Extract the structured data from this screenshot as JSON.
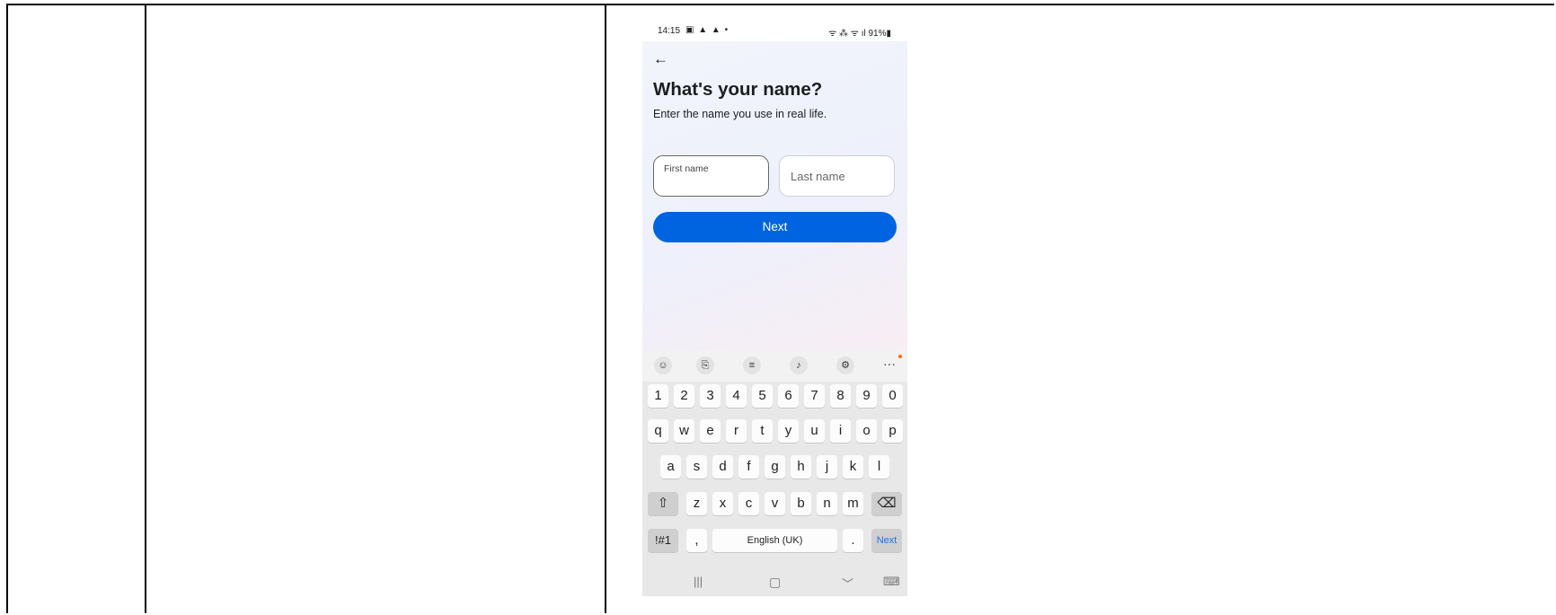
{
  "status_bar": {
    "time": "14:15",
    "left_icons": "▣ ▲ ▲ •",
    "right_text": "ᯤ ⁂ ᯤ ıl 91%▮",
    "battery_percent": "91%"
  },
  "screen": {
    "back_icon": "arrow-left-icon",
    "back_glyph": "←",
    "title": "What's your name?",
    "subtitle": "Enter the name you use in real life.",
    "first_name_label": "First name",
    "last_name_placeholder": "Last name",
    "next_label": "Next",
    "accent_color": "#0064e0"
  },
  "keyboard_toolbar": [
    {
      "name": "emoji-icon",
      "glyph": "☺"
    },
    {
      "name": "clipboard-icon",
      "glyph": "⎘"
    },
    {
      "name": "text-mode-icon",
      "glyph": "≡"
    },
    {
      "name": "microphone-icon",
      "glyph": "♪"
    },
    {
      "name": "settings-icon",
      "glyph": "⚙"
    },
    {
      "name": "more-icon",
      "glyph": "···"
    }
  ],
  "keyboard": {
    "row_numbers": [
      "1",
      "2",
      "3",
      "4",
      "5",
      "6",
      "7",
      "8",
      "9",
      "0"
    ],
    "row_top": [
      "q",
      "w",
      "e",
      "r",
      "t",
      "y",
      "u",
      "i",
      "o",
      "p"
    ],
    "row_home": [
      "a",
      "s",
      "d",
      "f",
      "g",
      "h",
      "j",
      "k",
      "l"
    ],
    "row_bottom": [
      "z",
      "x",
      "c",
      "v",
      "b",
      "n",
      "m"
    ],
    "shift_glyph": "⇧",
    "backspace_glyph": "⌫",
    "symbols_label": "!#1",
    "comma_label": ",",
    "space_label": "English (UK)",
    "period_label": ".",
    "action_label": "Next"
  },
  "nav_bar": {
    "recents_glyph": "|||",
    "home_glyph": "▢",
    "back_glyph": "﹀",
    "keyboard_glyph": "⌨"
  }
}
